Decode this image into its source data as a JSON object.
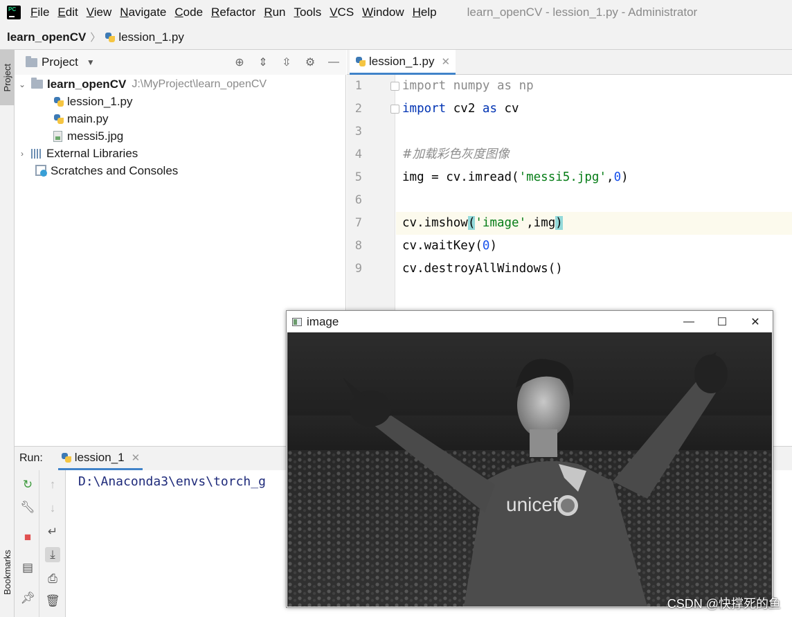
{
  "menubar": {
    "items": [
      "File",
      "Edit",
      "View",
      "Navigate",
      "Code",
      "Refactor",
      "Run",
      "Tools",
      "VCS",
      "Window",
      "Help"
    ],
    "window_title": "learn_openCV - lession_1.py - Administrator"
  },
  "breadcrumb": {
    "project": "learn_openCV",
    "file": "lession_1.py"
  },
  "sidebar": {
    "project_tab": "Project",
    "bookmarks_tab": "Bookmarks"
  },
  "project_panel": {
    "title": "Project",
    "root": {
      "name": "learn_openCV",
      "path": "J:\\MyProject\\learn_openCV"
    },
    "files": [
      "lession_1.py",
      "main.py",
      "messi5.jpg"
    ],
    "external_libraries": "External Libraries",
    "scratches": "Scratches and Consoles"
  },
  "editor": {
    "tab": "lession_1.py",
    "line_numbers": [
      "1",
      "2",
      "3",
      "4",
      "5",
      "6",
      "7",
      "8",
      "9"
    ],
    "code": {
      "l1_kw": "import",
      "l1_rest": " numpy ",
      "l1_as": "as",
      "l1_end": " np",
      "l2_kw": "import",
      "l2_rest": " cv2 ",
      "l2_as": "as",
      "l2_end": " cv",
      "l4_comment": "#加载彩色灰度图像",
      "l5_a": "img = cv.imread(",
      "l5_str": "'messi5.jpg'",
      "l5_comma": ",",
      "l5_num": "0",
      "l5_end": ")",
      "l7_a": "cv.imshow",
      "l7_open": "(",
      "l7_str": "'image'",
      "l7_mid": ",img",
      "l7_close": ")",
      "l8_a": "cv.waitKey(",
      "l8_num": "0",
      "l8_end": ")",
      "l9": "cv.destroyAllWindows()"
    },
    "colors": {
      "keyword": "#0033b3",
      "string": "#067d17",
      "number": "#1750eb",
      "comment": "#8c8c8c"
    }
  },
  "run_panel": {
    "label": "Run:",
    "tab": "lession_1",
    "console_line": "D:\\Anaconda3\\envs\\torch_g"
  },
  "image_window": {
    "title": "image",
    "controls": {
      "minimize": "—",
      "maximize": "☐",
      "close": "✕"
    }
  },
  "watermark": "CSDN @快撑死的鱼"
}
